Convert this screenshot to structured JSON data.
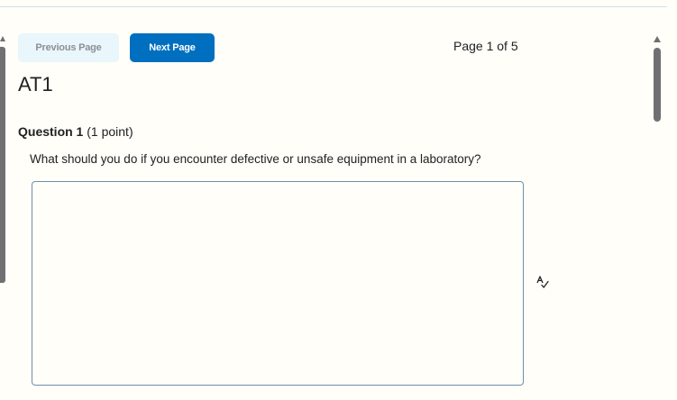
{
  "navigation": {
    "previous_label": "Previous Page",
    "next_label": "Next Page",
    "page_indicator": "Page 1 of 5"
  },
  "quiz": {
    "title": "AT1"
  },
  "question": {
    "number_label": "Question 1",
    "points_label": "(1 point)",
    "text": "What should you do if you encounter defective or unsafe equipment in a laboratory?",
    "answer_value": ""
  },
  "icons": {
    "spellcheck": "spellcheck-icon"
  },
  "colors": {
    "primary_button": "#006fbf",
    "disabled_button": "#e9f6fc",
    "disabled_text": "#8d9094",
    "scrollbar": "#6f7072",
    "background": "#fffef9"
  }
}
